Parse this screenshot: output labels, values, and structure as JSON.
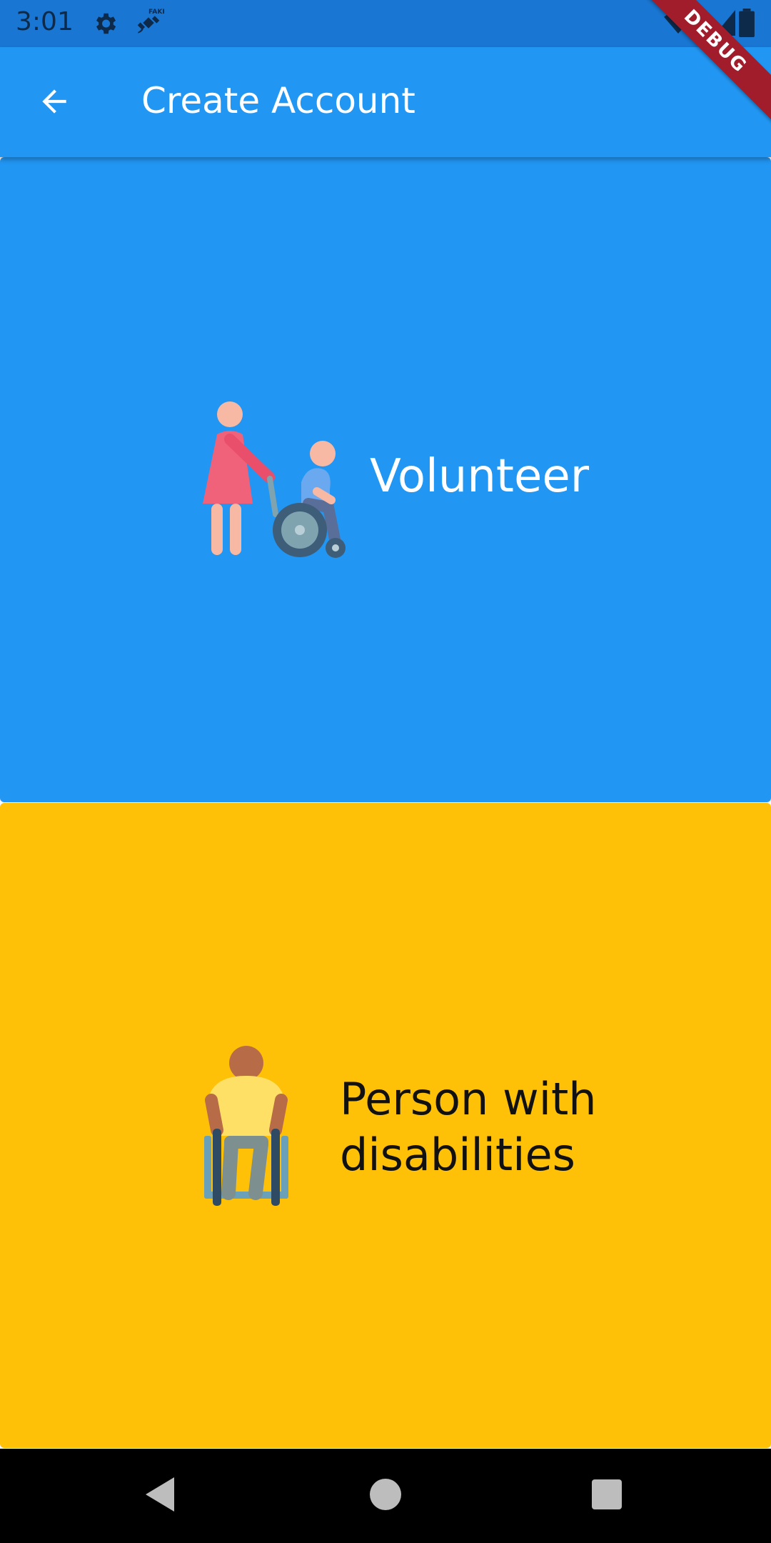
{
  "status_bar": {
    "time": "3:01",
    "icons": [
      "gear-icon",
      "satellite-icon",
      "wifi-icon",
      "signal-icon",
      "battery-icon"
    ]
  },
  "app_bar": {
    "title": "Create Account",
    "back_icon": "arrow-back-icon"
  },
  "debug_banner": "DEBUG",
  "options": {
    "volunteer": {
      "label": "Volunteer",
      "icon": "volunteer-wheelchair-icon",
      "color": "#2196F3"
    },
    "disability": {
      "label_line1": "Person with",
      "label_line2": "disabilities",
      "icon": "wheelchair-person-icon",
      "color": "#FFC107"
    }
  },
  "nav_bar": {
    "icons": [
      "back-triangle-icon",
      "home-circle-icon",
      "recents-square-icon"
    ]
  },
  "colors": {
    "status_bar": "#1976D2",
    "app_bar": "#2196F3",
    "volunteer_bg": "#2196F3",
    "disability_bg": "#FFC107"
  }
}
